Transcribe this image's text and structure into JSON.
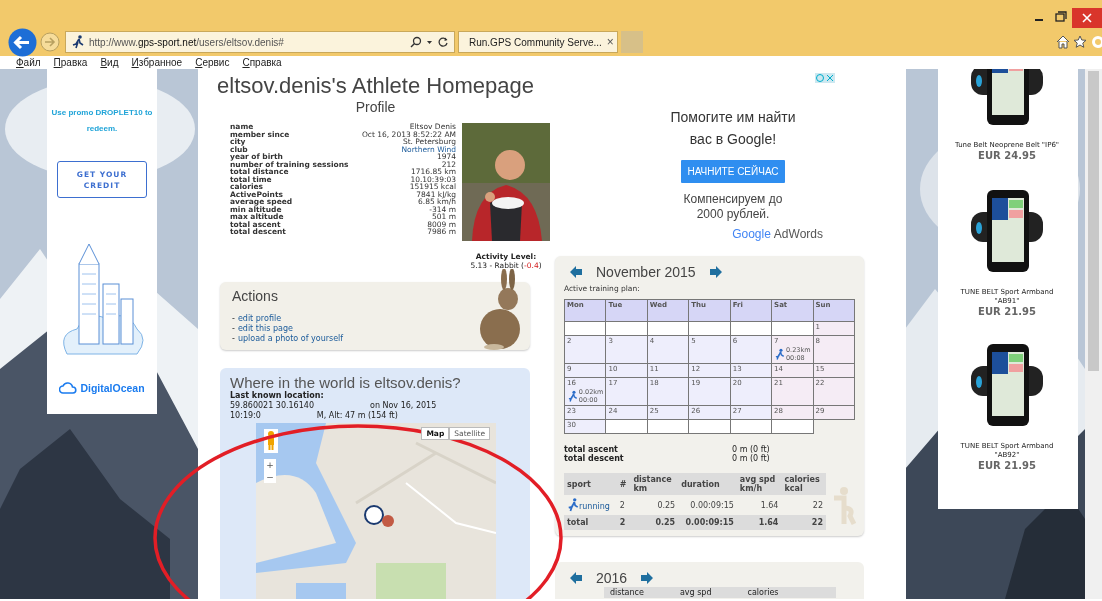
{
  "browser": {
    "address": "http://www.**gps-sport.net**/users/eltsov.denis#",
    "tabs": [
      {
        "title": "Run.GPS Community Serve...",
        "close": "×",
        "selected": true
      }
    ],
    "menu": [
      "Файл",
      "Правка",
      "Вид",
      "Избранное",
      "Сервис",
      "Справка"
    ]
  },
  "left_ad": {
    "promo": "Use promo **DROPLET10** to redeem.",
    "button": "GET YOUR CREDIT",
    "brand": "DigitalOcean"
  },
  "page": {
    "title": "eltsov.denis's Athlete Homepage",
    "subtitle": "Profile",
    "profile": [
      {
        "label": "name",
        "value": "Eltsov Denis"
      },
      {
        "label": "member since",
        "value": "Oct 16, 2013 8:52:22 AM"
      },
      {
        "label": "city",
        "value": "St. Petersburg"
      },
      {
        "label": "club",
        "value": "Northern Wind",
        "kind": "link"
      },
      {
        "label": "year of birth",
        "value": "1974"
      },
      {
        "label": "number of training sessions",
        "value": "212"
      },
      {
        "label": "total distance",
        "value": "1716.85 km"
      },
      {
        "label": "total time",
        "value": "10.10:39:03"
      },
      {
        "label": "calories",
        "value": "151915 kcal"
      },
      {
        "label": "ActivePoints",
        "value": "7841 kJ/kg"
      },
      {
        "label": "average speed",
        "value": "6.85 km/h"
      },
      {
        "label": "min altitude",
        "value": "-314 m"
      },
      {
        "label": "max altitude",
        "value": "501 m"
      },
      {
        "label": "total ascent",
        "value": "8009 m"
      },
      {
        "label": "total descent",
        "value": "7986 m"
      }
    ],
    "activity_level": {
      "label": "Activity Level:",
      "value": "5.13 - Rabbit (",
      "change": "-0.4",
      "suffix": ")"
    },
    "actions": {
      "title": "Actions",
      "links": [
        {
          "bullet": "-",
          "label": "edit profile"
        },
        {
          "bullet": "-",
          "label": "edit this page"
        },
        {
          "bullet": "-",
          "label": "upload a photo of yourself"
        }
      ]
    },
    "location": {
      "title": "Where in the world is eltsov.denis?",
      "label": "Last known location:",
      "lines": [
        [
          "59.860021 30.16140",
          "on Nov 16, 2015"
        ],
        [
          "10:19:0",
          "M, Alt: 47 m (154 ft)"
        ]
      ],
      "map": {
        "types": [
          {
            "label": "Map",
            "selected": true
          },
          {
            "label": "Satellite",
            "selected": false
          }
        ],
        "zoom_in": "+",
        "zoom_out": "−"
      }
    }
  },
  "google_ad": {
    "headline": "Помогите им найти вас в Google!",
    "button": "НАЧНИТЕ СЕЙЧАС",
    "offer": "Компенсируем до 2000 рублей.",
    "brand": "Google",
    "product": "AdWords"
  },
  "calendar": {
    "month": "November 2015",
    "plan_label": "Active training plan:",
    "weekdays": [
      "Mon",
      "Tue",
      "Wed",
      "Thu",
      "Fri",
      "Sat",
      "Sun"
    ],
    "weeks": [
      [
        {
          "empty": true
        },
        {
          "empty": true
        },
        {
          "empty": true
        },
        {
          "empty": true
        },
        {
          "empty": true
        },
        {
          "empty": true
        },
        {
          "day": "1"
        }
      ],
      [
        {
          "day": "2"
        },
        {
          "day": "3"
        },
        {
          "day": "4"
        },
        {
          "day": "5"
        },
        {
          "day": "6"
        },
        {
          "day": "7",
          "activity": {
            "distance": "0.23",
            "unit": "km",
            "time": "00:08"
          }
        },
        {
          "day": "8"
        }
      ],
      [
        {
          "day": "9"
        },
        {
          "day": "10"
        },
        {
          "day": "11"
        },
        {
          "day": "12"
        },
        {
          "day": "13"
        },
        {
          "day": "14"
        },
        {
          "day": "15"
        }
      ],
      [
        {
          "day": "16",
          "activity": {
            "distance": "0.02",
            "unit": "km",
            "time": "00:00"
          }
        },
        {
          "day": "17"
        },
        {
          "day": "18"
        },
        {
          "day": "19"
        },
        {
          "day": "20"
        },
        {
          "day": "21"
        },
        {
          "day": "22"
        }
      ],
      [
        {
          "day": "23"
        },
        {
          "day": "24"
        },
        {
          "day": "25"
        },
        {
          "day": "26"
        },
        {
          "day": "27"
        },
        {
          "day": "28"
        },
        {
          "day": "29"
        }
      ],
      [
        {
          "day": "30"
        },
        {
          "empty": true
        },
        {
          "empty": true
        },
        {
          "empty": true
        },
        {
          "empty": true
        },
        {
          "empty": true
        }
      ]
    ],
    "totals": [
      {
        "label": "total ascent",
        "value": "0 m (0 ft)"
      },
      {
        "label": "total descent",
        "value": "0 m (0 ft)"
      }
    ],
    "sport_table": {
      "columns": [
        {
          "label": "sport"
        },
        {
          "label": "#"
        },
        {
          "label": "distance",
          "unit": "km"
        },
        {
          "label": "duration"
        },
        {
          "label": "avg spd",
          "unit": "km/h"
        },
        {
          "label": "calories",
          "unit": "kcal"
        }
      ],
      "rows": [
        {
          "kind": "sport",
          "cells": [
            "running",
            "2",
            "0.25",
            "0.00:09:15",
            "1.64",
            "22"
          ]
        },
        {
          "kind": "total",
          "cells": [
            "total",
            "2",
            "0.25",
            "0.00:09:15",
            "1.64",
            "22"
          ]
        }
      ]
    }
  },
  "year_card": {
    "year": "2016",
    "columns": [
      "distance",
      "avg spd",
      "calories"
    ]
  },
  "right_ad": {
    "products": [
      {
        "name": "Tune Belt Neoprene Belt \"IP6\"",
        "price": "EUR 24.95"
      },
      {
        "name": "TUNE BELT Sport Armband \"AB91\"",
        "price": "EUR 21.95"
      },
      {
        "name": "TUNE BELT Sport Armband \"AB92\"",
        "price": "EUR 21.95"
      }
    ]
  }
}
